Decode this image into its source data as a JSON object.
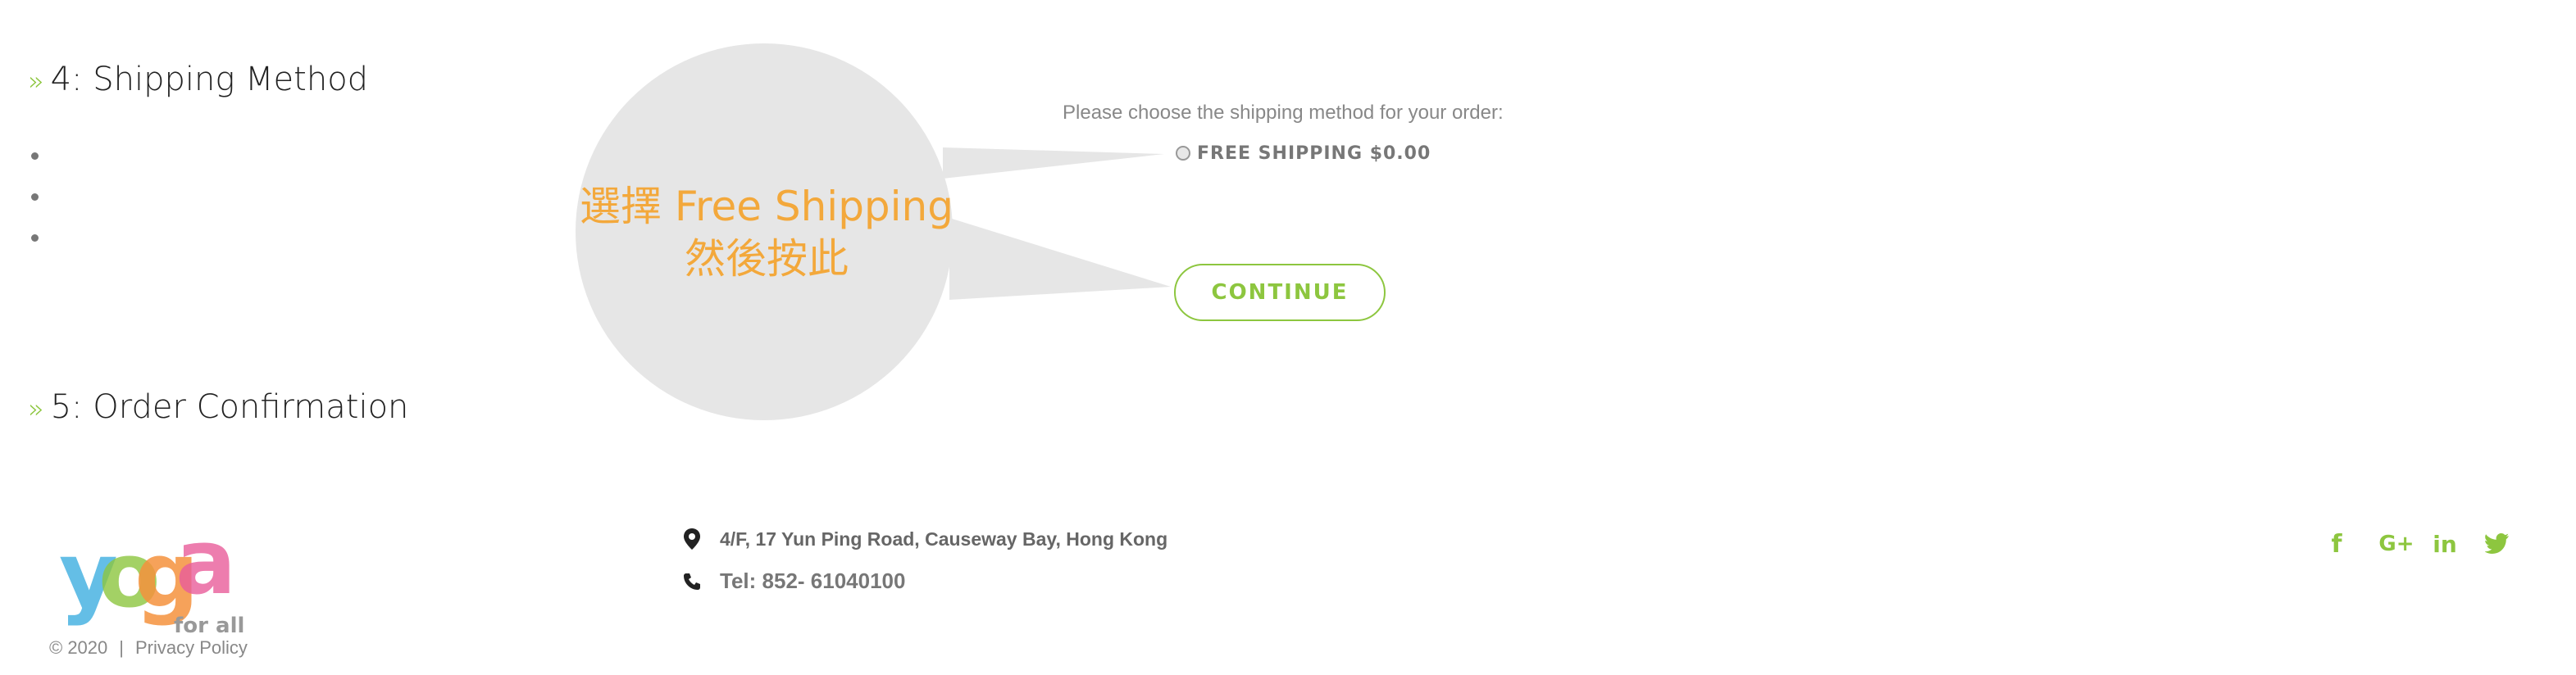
{
  "checkout": {
    "step4": {
      "arrow": "»",
      "title": "4: Shipping Method"
    },
    "step5": {
      "arrow": "»",
      "title": "5: Order Confirmation"
    }
  },
  "shipping": {
    "prompt": "Please choose the shipping method for your order:",
    "option_label": "FREE SHIPPING $0.00",
    "option_selected": false,
    "continue_label": "CONTINUE"
  },
  "annotation": {
    "line1": "選擇 Free Shipping",
    "line2": "然後按此"
  },
  "footer": {
    "logo_text": "yoga",
    "logo_sub": "for all",
    "copyright": "©  2020",
    "separator": "|",
    "privacy_label": "Privacy Policy",
    "address": "4/F, 17 Yun Ping Road, Causeway Bay, Hong Kong",
    "tel": "Tel: 852- 61040100",
    "social": [
      "facebook-icon",
      "google-plus-icon",
      "linkedin-icon",
      "twitter-icon"
    ]
  },
  "colors": {
    "accent": "#8dc63f",
    "annotation_text": "#f3a83b",
    "bubble": "#e6e6e6"
  }
}
